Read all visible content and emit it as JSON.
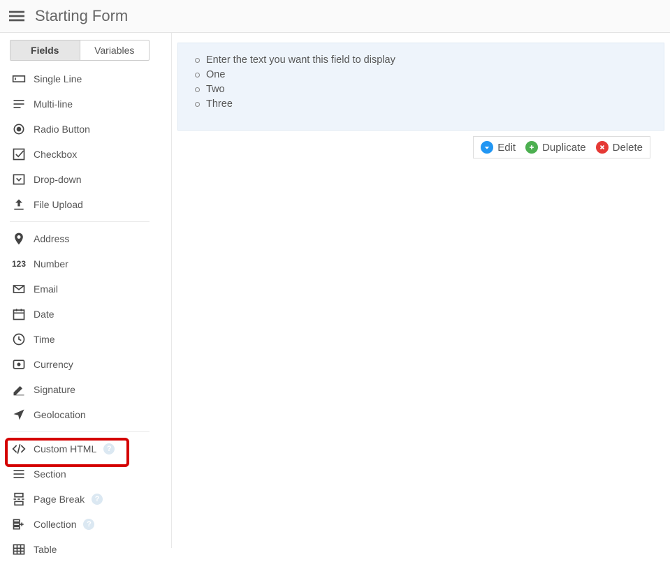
{
  "header": {
    "title": "Starting Form"
  },
  "sidebar": {
    "tabs": {
      "fields": "Fields",
      "variables": "Variables",
      "active": "fields"
    },
    "group1": [
      {
        "label": "Single Line"
      },
      {
        "label": "Multi-line"
      },
      {
        "label": "Radio Button"
      },
      {
        "label": "Checkbox"
      },
      {
        "label": "Drop-down"
      },
      {
        "label": "File Upload"
      }
    ],
    "group2": [
      {
        "label": "Address"
      },
      {
        "label": "Number"
      },
      {
        "label": "Email"
      },
      {
        "label": "Date"
      },
      {
        "label": "Time"
      },
      {
        "label": "Currency"
      },
      {
        "label": "Signature"
      },
      {
        "label": "Geolocation"
      }
    ],
    "group3": [
      {
        "label": "Custom HTML",
        "help": true
      },
      {
        "label": "Section"
      },
      {
        "label": "Page Break",
        "help": true
      },
      {
        "label": "Collection",
        "help": true
      },
      {
        "label": "Table"
      }
    ],
    "highlighted": "Custom HTML"
  },
  "canvas": {
    "field": {
      "placeholder_text": "Enter the text you want this field to display",
      "items": [
        "One",
        "Two",
        "Three"
      ]
    },
    "actions": {
      "edit": "Edit",
      "duplicate": "Duplicate",
      "delete": "Delete"
    }
  }
}
